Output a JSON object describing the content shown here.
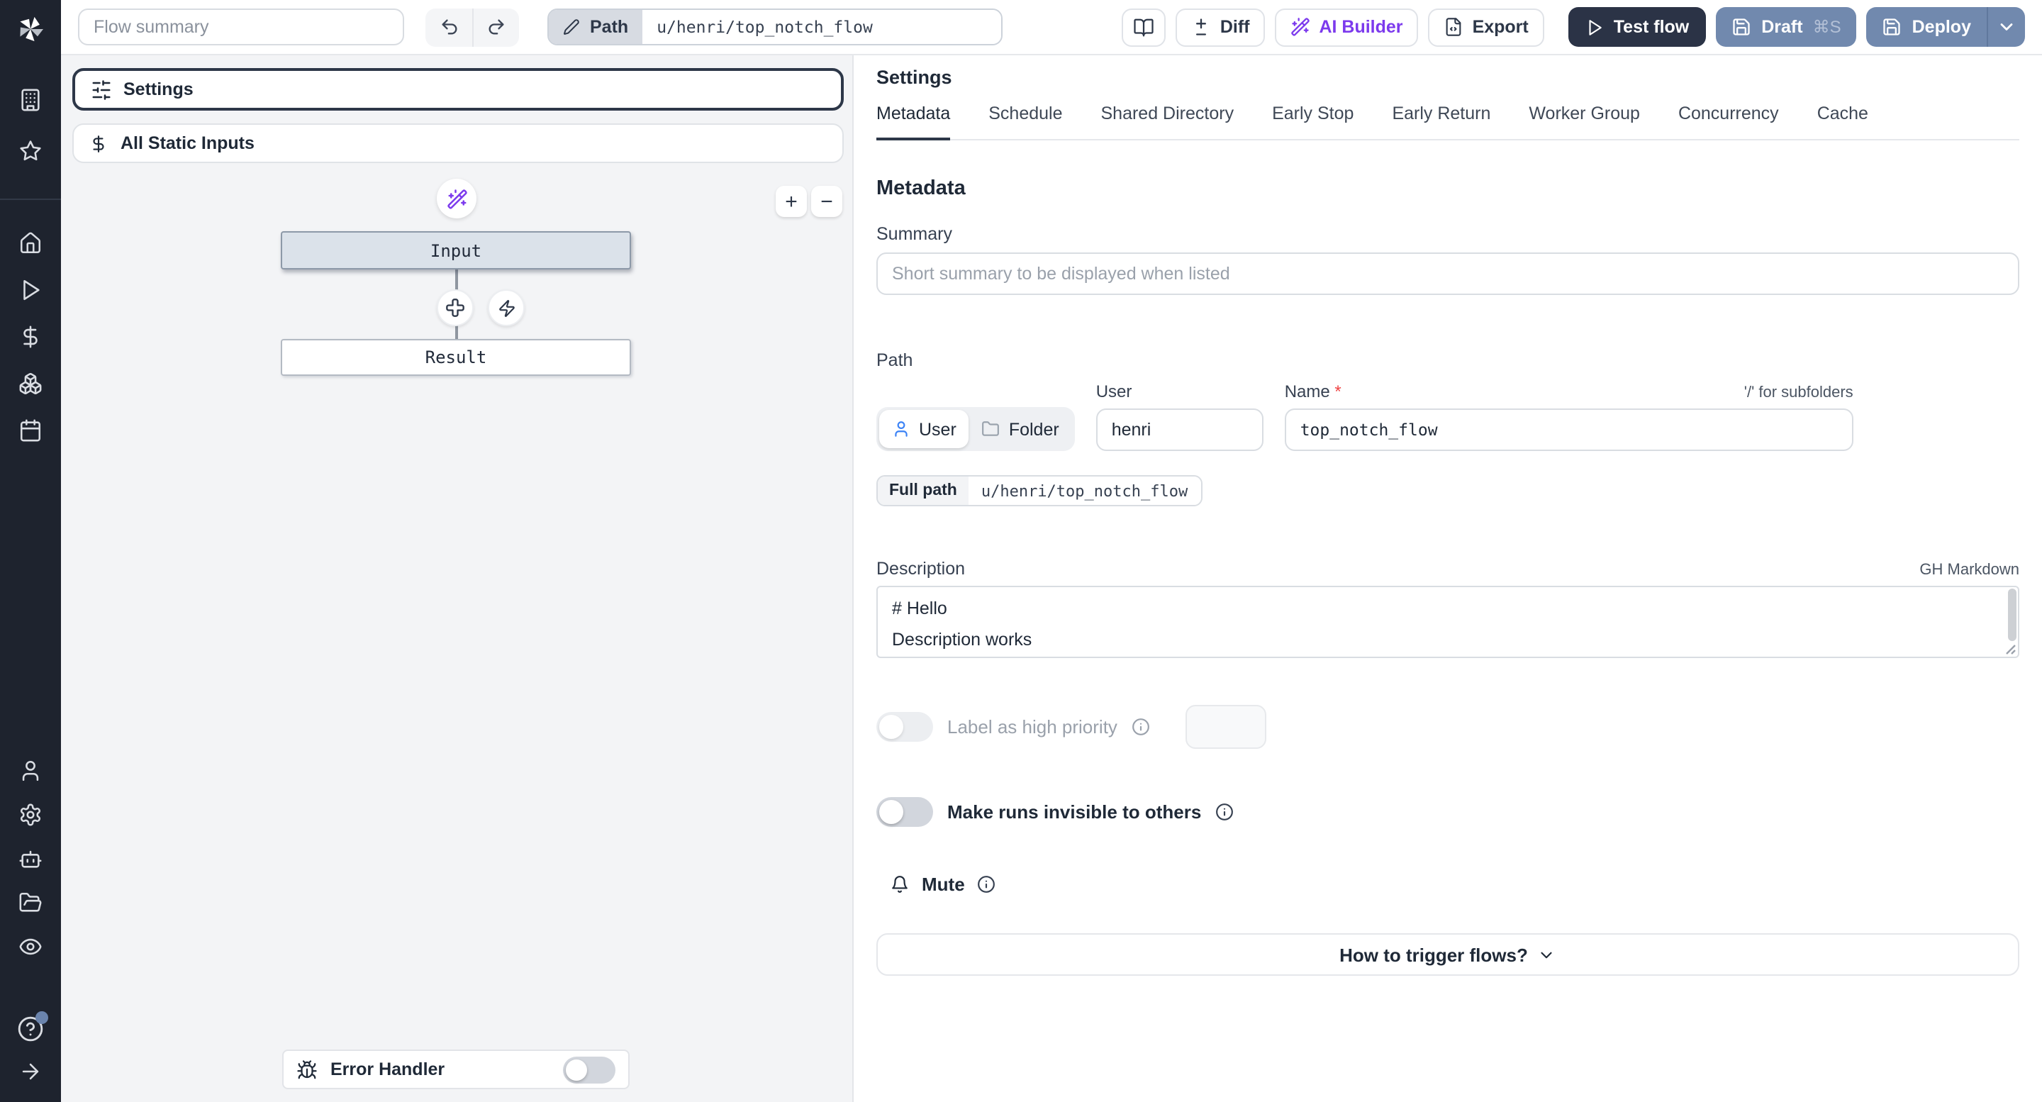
{
  "topbar": {
    "flow_summary_placeholder": "Flow summary",
    "path_label": "Path",
    "path_value": "u/henri/top_notch_flow",
    "diff_label": "Diff",
    "ai_builder_label": "AI Builder",
    "export_label": "Export",
    "test_flow_label": "Test flow",
    "draft_label": "Draft",
    "draft_shortcut": "⌘S",
    "deploy_label": "Deploy"
  },
  "flow_panel": {
    "settings_label": "Settings",
    "static_inputs_label": "All Static Inputs",
    "zoom_in": "+",
    "zoom_out": "−",
    "nodes": {
      "input": "Input",
      "result": "Result"
    },
    "error_handler_label": "Error Handler"
  },
  "settings_panel": {
    "title": "Settings",
    "tabs": [
      "Metadata",
      "Schedule",
      "Shared Directory",
      "Early Stop",
      "Early Return",
      "Worker Group",
      "Concurrency",
      "Cache"
    ],
    "metadata": {
      "heading": "Metadata",
      "summary_label": "Summary",
      "summary_placeholder": "Short summary to be displayed when listed",
      "path_label": "Path",
      "owner_user_label": "User",
      "owner_folder_label": "Folder",
      "user_field_label": "User",
      "user_value": "henri",
      "name_label": "Name",
      "name_required_mark": "*",
      "name_value": "top_notch_flow",
      "subfolder_hint": "'/' for subfolders",
      "full_path_label": "Full path",
      "full_path_value": "u/henri/top_notch_flow",
      "description_label": "Description",
      "markdown_hint": "GH Markdown",
      "description_value": "# Hello\nDescription works",
      "high_priority_label": "Label as high priority",
      "invisible_runs_label": "Make runs invisible to others",
      "mute_label": "Mute",
      "trigger_label": "How to trigger flows?"
    }
  },
  "colors": {
    "sidebar_bg": "#1e232e",
    "canvas_bg": "#f3f4f6",
    "primary_dark": "#2b3346",
    "slate_button": "#7189ae",
    "ai_purple": "#7c3aed",
    "selected_node_bg": "#dbe2ea",
    "required_red": "#ef4444",
    "user_icon_blue": "#3b82f6"
  }
}
